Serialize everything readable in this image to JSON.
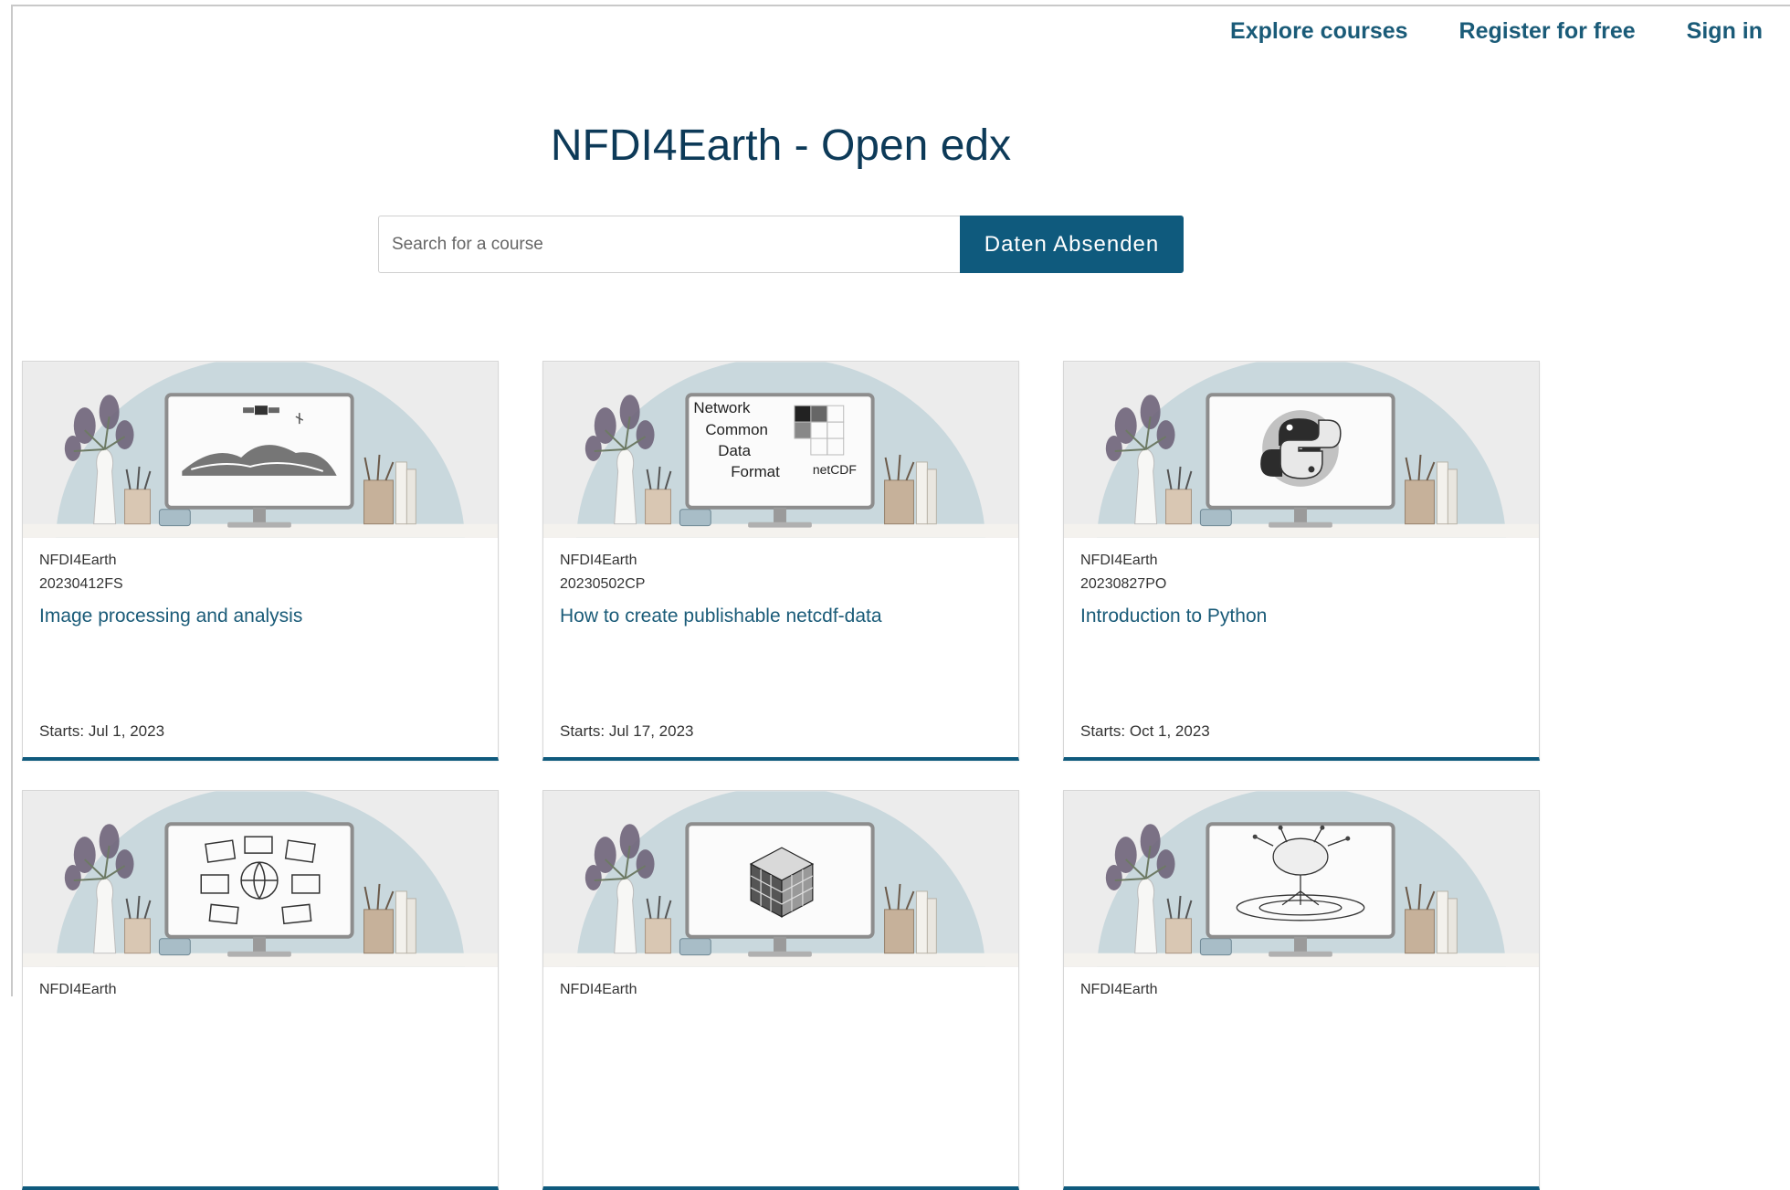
{
  "nav": {
    "explore": "Explore courses",
    "register": "Register for free",
    "signin": "Sign in"
  },
  "hero": {
    "title": "NFDI4Earth - Open edx"
  },
  "search": {
    "placeholder": "Search for a course",
    "button": "Daten Absenden"
  },
  "colors": {
    "accent": "#0f5a7d",
    "title": "#0d3a58",
    "link": "#1a5b78"
  },
  "courses": [
    {
      "org": "NFDI4Earth",
      "code": "20230412FS",
      "title": "Image processing and analysis",
      "starts": "Starts: Jul 1, 2023",
      "image_icon": "satellite-landscape-illustration"
    },
    {
      "org": "NFDI4Earth",
      "code": "20230502CP",
      "title": "How to create publishable netcdf-data",
      "starts": "Starts: Jul 17, 2023",
      "image_icon": "netcdf-illustration",
      "image_text": [
        "Network",
        "Common",
        "Data",
        "Format",
        "netCDF"
      ]
    },
    {
      "org": "NFDI4Earth",
      "code": "20230827PO",
      "title": "Introduction to Python",
      "starts": "Starts: Oct 1, 2023",
      "image_icon": "python-logo-illustration"
    },
    {
      "org": "NFDI4Earth",
      "image_icon": "globe-maps-illustration"
    },
    {
      "org": "NFDI4Earth",
      "image_icon": "data-cube-illustration"
    },
    {
      "org": "NFDI4Earth",
      "image_icon": "tree-network-illustration"
    }
  ]
}
